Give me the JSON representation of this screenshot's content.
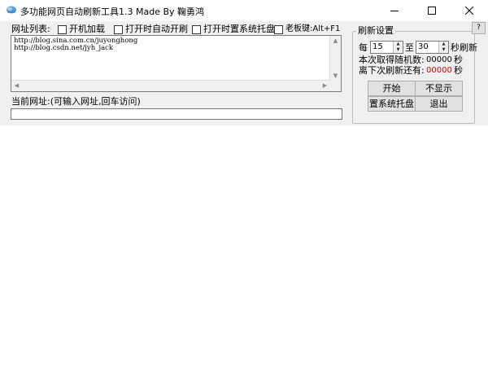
{
  "window": {
    "title": "多功能网页自动刷新工具1.3 Made By 鞠勇鸿",
    "icon": "app-icon",
    "controls": {
      "minimize": "minimize-icon",
      "maximize": "maximize-icon",
      "close": "close-icon"
    }
  },
  "url_list": {
    "label": "网址列表:",
    "lines": [
      "http://blog.sina.com.cn/juyonghong",
      "http://blog.csdn.net/jyh_jack"
    ]
  },
  "options": {
    "autoload": "开机加载",
    "auto_refresh": "打开时自动开刷",
    "tray": "打开时置系统托盘",
    "boss_key": "老板键:Alt+F1"
  },
  "current_url": {
    "label": "当前网址:(可输入网址,回车访问)",
    "value": ""
  },
  "refresh_settings": {
    "title": "刷新设置",
    "every_label": "每",
    "min_value": "15",
    "to_label": "至",
    "max_value": "30",
    "unit_refresh": "秒刷新",
    "random_label": "本次取得随机数:",
    "random_value": "00000",
    "next_label": "离下次刷新还有:",
    "next_value": "00000",
    "sec_unit": "秒",
    "countdown_color": "#e00000"
  },
  "buttons": {
    "start": "开始",
    "hide": "不显示",
    "tray": "置系统托盘",
    "exit": "退出",
    "help": "?"
  }
}
